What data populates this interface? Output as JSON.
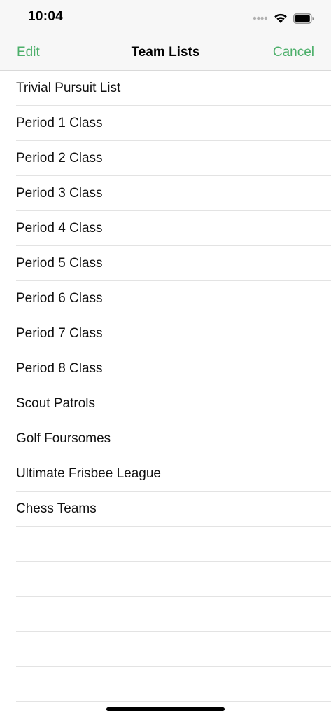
{
  "status_bar": {
    "time": "10:04",
    "icons": [
      "signal-dots-icon",
      "wifi-icon",
      "battery-icon"
    ]
  },
  "nav": {
    "left_label": "Edit",
    "title": "Team Lists",
    "right_label": "Cancel",
    "accent_color": "#4caf6a"
  },
  "lists": [
    {
      "label": "Trivial Pursuit List"
    },
    {
      "label": "Period 1 Class"
    },
    {
      "label": "Period 2 Class"
    },
    {
      "label": "Period 3 Class"
    },
    {
      "label": "Period 4 Class"
    },
    {
      "label": "Period 5 Class"
    },
    {
      "label": "Period 6 Class"
    },
    {
      "label": "Period 7 Class"
    },
    {
      "label": "Period 8 Class"
    },
    {
      "label": "Scout Patrols"
    },
    {
      "label": "Golf Foursomes"
    },
    {
      "label": "Ultimate Frisbee League"
    },
    {
      "label": "Chess Teams"
    }
  ]
}
